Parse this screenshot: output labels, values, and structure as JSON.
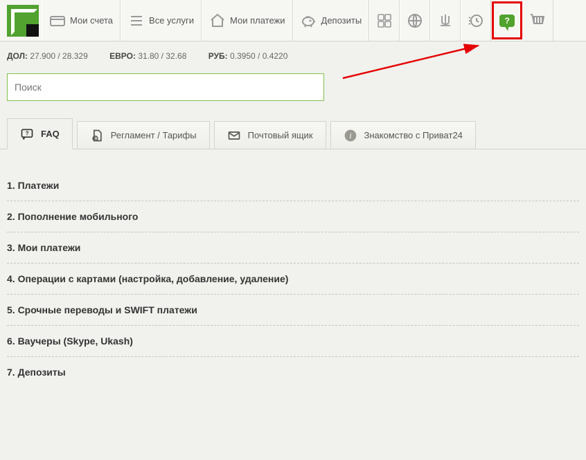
{
  "nav": {
    "accounts": "Мои счета",
    "services": "Все услуги",
    "payments": "Мои платежи",
    "deposits": "Депозиты"
  },
  "rates": {
    "usd_label": "ДОЛ:",
    "usd": "27.900 / 28.329",
    "eur_label": "ЕВРО:",
    "eur": "31.80 / 32.68",
    "rub_label": "РУБ:",
    "rub": "0.3950 / 0.4220"
  },
  "search": {
    "placeholder": "Поиск"
  },
  "tabs": {
    "faq": "FAQ",
    "tariffs": "Регламент / Тарифы",
    "mailbox": "Почтовый ящик",
    "intro": "Знакомство с Приват24"
  },
  "faq": [
    "1. Платежи",
    "2. Пополнение мобильного",
    "3. Мои платежи",
    "4. Операции с картами (настройка, добавление, удаление)",
    "5. Срочные переводы и SWIFT платежи",
    "6. Ваучеры (Skype, Ukash)",
    "7. Депозиты"
  ],
  "help_symbol": "?"
}
